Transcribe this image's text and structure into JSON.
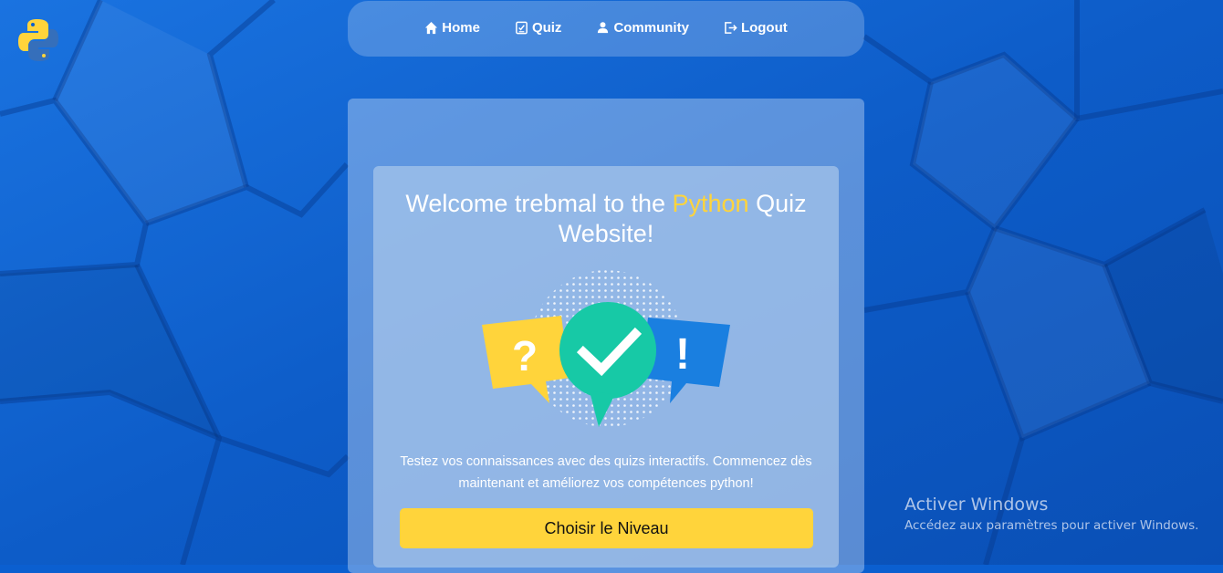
{
  "colors": {
    "background": "#0b5fd0",
    "accent_yellow": "#ffd43b",
    "check_green": "#17c9a6",
    "bubble_blue": "#1a7fe0",
    "text_white": "#ffffff"
  },
  "logo": {
    "icon": "python-logo-icon"
  },
  "nav": {
    "items": [
      {
        "label": "Home",
        "icon": "home-icon"
      },
      {
        "label": "Quiz",
        "icon": "quiz-checklist-icon"
      },
      {
        "label": "Community",
        "icon": "user-icon"
      },
      {
        "label": "Logout",
        "icon": "logout-icon"
      }
    ]
  },
  "welcome": {
    "before": "Welcome trebmal to the ",
    "highlight": "Python",
    "after": " Quiz Website!"
  },
  "illustration": {
    "icon": "quiz-bubbles-illustration",
    "question_mark": "?",
    "exclamation_mark": "!"
  },
  "description": "Testez vos connaissances avec des quizs interactifs. Commencez dès maintenant et améliorez vos compétences python!",
  "cta": {
    "label": "Choisir le Niveau"
  },
  "windows_watermark": {
    "title": "Activer Windows",
    "subtitle": "Accédez aux paramètres pour activer Windows."
  }
}
